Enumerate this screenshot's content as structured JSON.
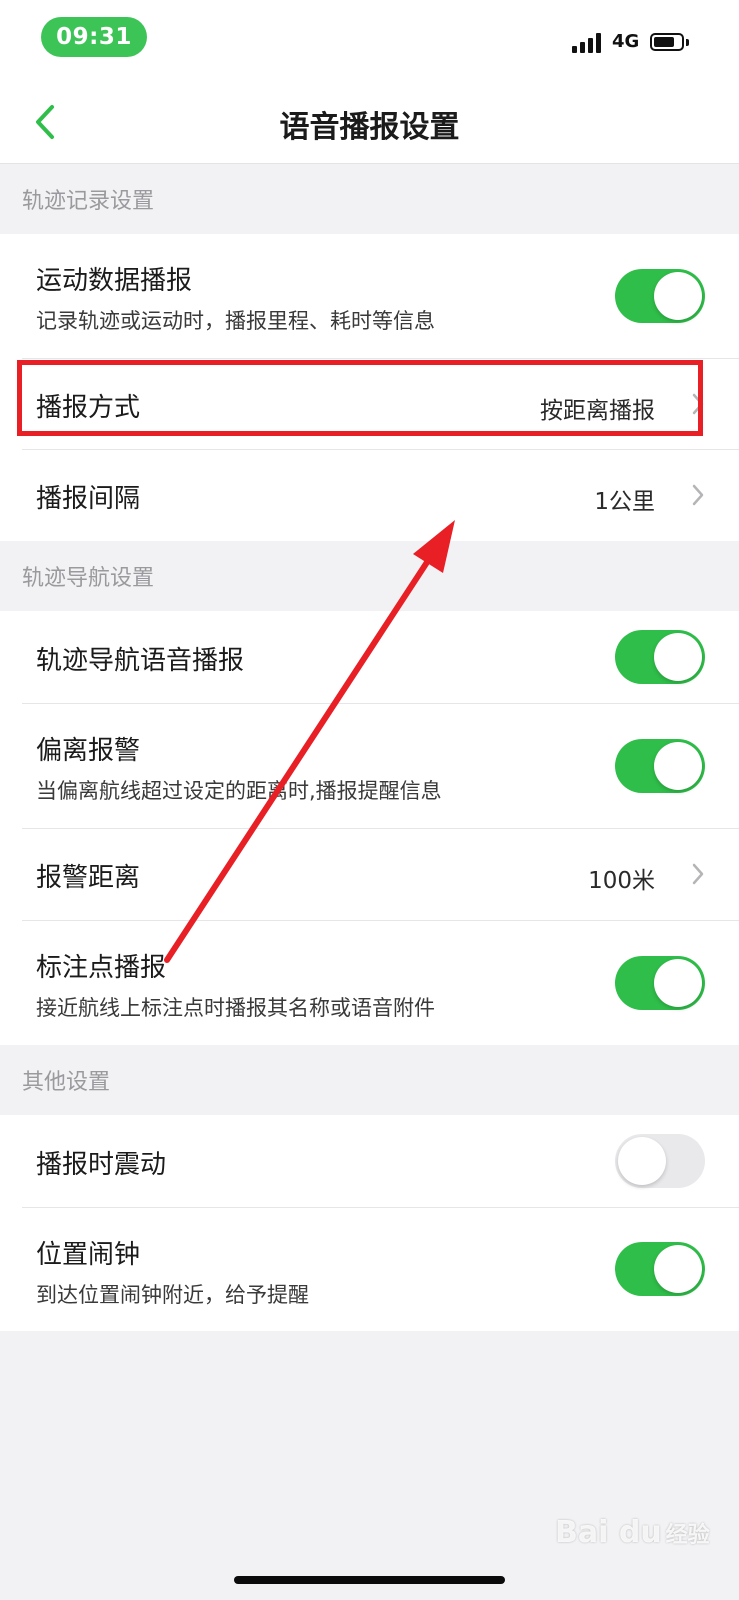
{
  "status_bar": {
    "time": "09:31",
    "network": "4G"
  },
  "nav": {
    "title": "语音播报设置"
  },
  "sections": [
    {
      "header": "轨迹记录设置",
      "rows": [
        {
          "label": "运动数据播报",
          "desc": "记录轨迹或运动时，播报里程、耗时等信息",
          "toggle": true
        },
        {
          "label": "播报方式",
          "value": "按距离播报"
        },
        {
          "label": "播报间隔",
          "value": "1公里"
        }
      ]
    },
    {
      "header": "轨迹导航设置",
      "rows": [
        {
          "label": "轨迹导航语音播报",
          "toggle": true
        },
        {
          "label": "偏离报警",
          "desc": "当偏离航线超过设定的距离时,播报提醒信息",
          "toggle": true
        },
        {
          "label": "报警距离",
          "value": "100米"
        },
        {
          "label": "标注点播报",
          "desc": "接近航线上标注点时播报其名称或语音附件",
          "toggle": true
        }
      ]
    },
    {
      "header": "其他设置",
      "rows": [
        {
          "label": "播报时震动",
          "toggle": false
        },
        {
          "label": "位置闹钟",
          "desc": "到达位置闹钟附近，给予提醒",
          "toggle": true
        }
      ]
    }
  ],
  "watermark": {
    "brand": "Bai du",
    "suffix": "经验"
  },
  "colors": {
    "accent": "#2fbe49",
    "annotation": "#e81f25"
  }
}
